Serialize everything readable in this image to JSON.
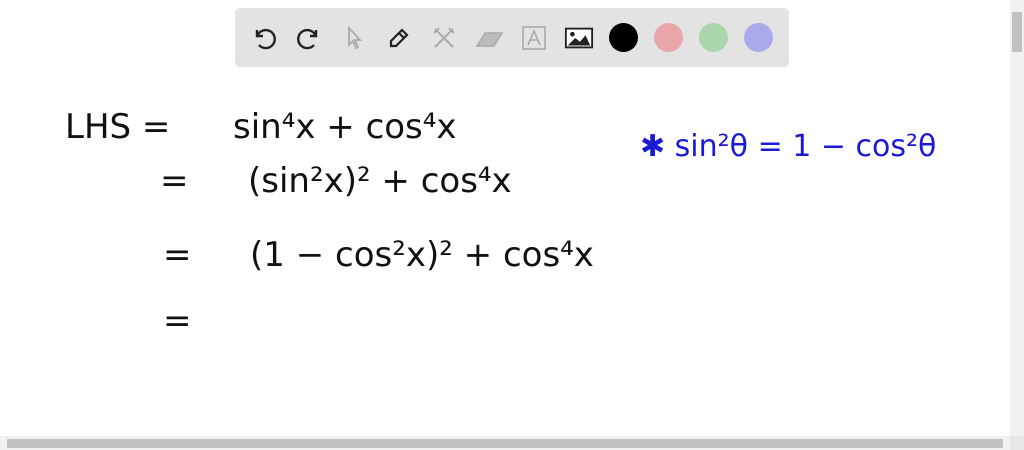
{
  "toolbar": {
    "tools": [
      "undo-icon",
      "redo-icon",
      "select-icon",
      "pen-icon",
      "tools-icon",
      "eraser-icon",
      "text-icon",
      "image-icon"
    ],
    "colors": {
      "black": "#000000",
      "red": "#e8a6ab",
      "green": "#abd6ab",
      "purple": "#aaaaea"
    }
  },
  "board": {
    "lines": [
      {
        "lhs": "LHS =",
        "rhs": "sin⁴x + cos⁴x"
      },
      {
        "lhs": "=",
        "rhs": "(sin²x)² + cos⁴x"
      },
      {
        "lhs": "=",
        "rhs": "(1 − cos²x)² + cos⁴x"
      },
      {
        "lhs": "=",
        "rhs": ""
      }
    ],
    "note": "✱ sin²θ = 1 − cos²θ",
    "note_color": "#1a1ad6"
  }
}
